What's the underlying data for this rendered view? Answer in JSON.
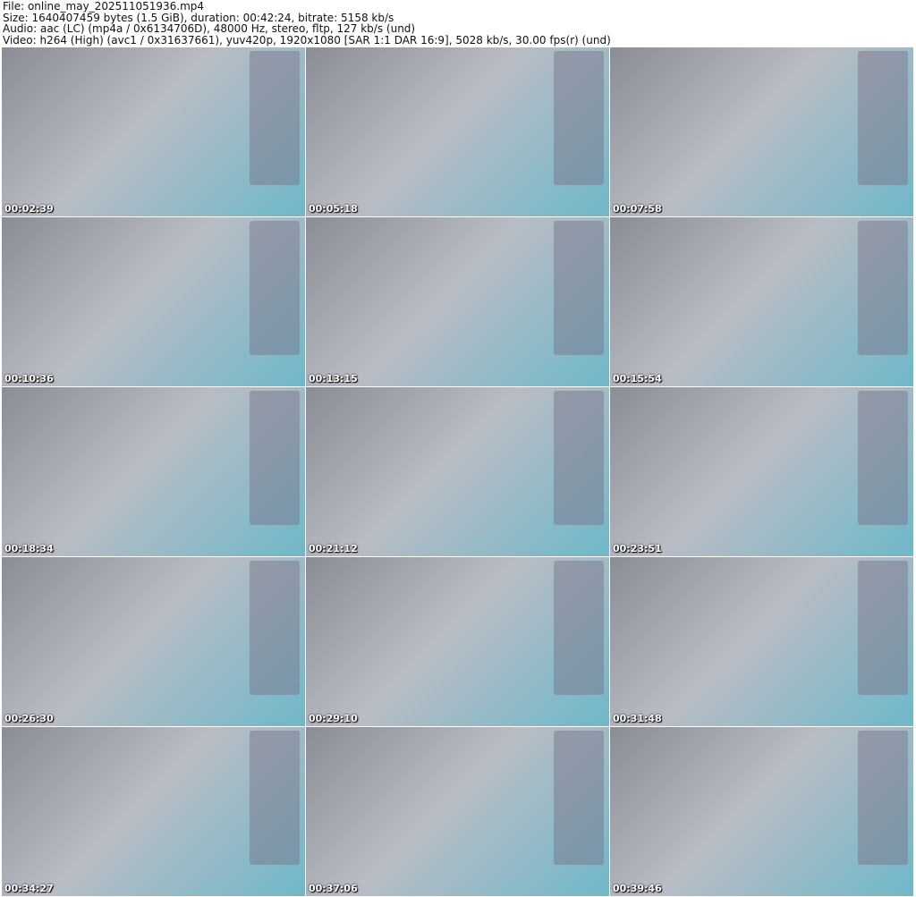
{
  "header": {
    "file": "File: online_may_202511051936.mp4",
    "size": "Size: 1640407459 bytes (1.5 GiB), duration: 00:42:24, bitrate: 5158 kb/s",
    "audio": "Audio: aac (LC) (mp4a / 0x6134706D), 48000 Hz, stereo, fltp, 127 kb/s (und)",
    "video": "Video: h264 (High) (avc1 / 0x31637661), yuv420p, 1920x1080 [SAR 1:1 DAR 16:9], 5028 kb/s, 30.00 fps(r) (und)"
  },
  "frames": [
    {
      "timestamp": "00:02:39"
    },
    {
      "timestamp": "00:05:18"
    },
    {
      "timestamp": "00:07:58"
    },
    {
      "timestamp": "00:10:36"
    },
    {
      "timestamp": "00:13:15"
    },
    {
      "timestamp": "00:15:54"
    },
    {
      "timestamp": "00:18:34"
    },
    {
      "timestamp": "00:21:12"
    },
    {
      "timestamp": "00:23:51"
    },
    {
      "timestamp": "00:26:30"
    },
    {
      "timestamp": "00:29:10"
    },
    {
      "timestamp": "00:31:48"
    },
    {
      "timestamp": "00:34:27"
    },
    {
      "timestamp": "00:37:06"
    },
    {
      "timestamp": "00:39:46"
    }
  ]
}
